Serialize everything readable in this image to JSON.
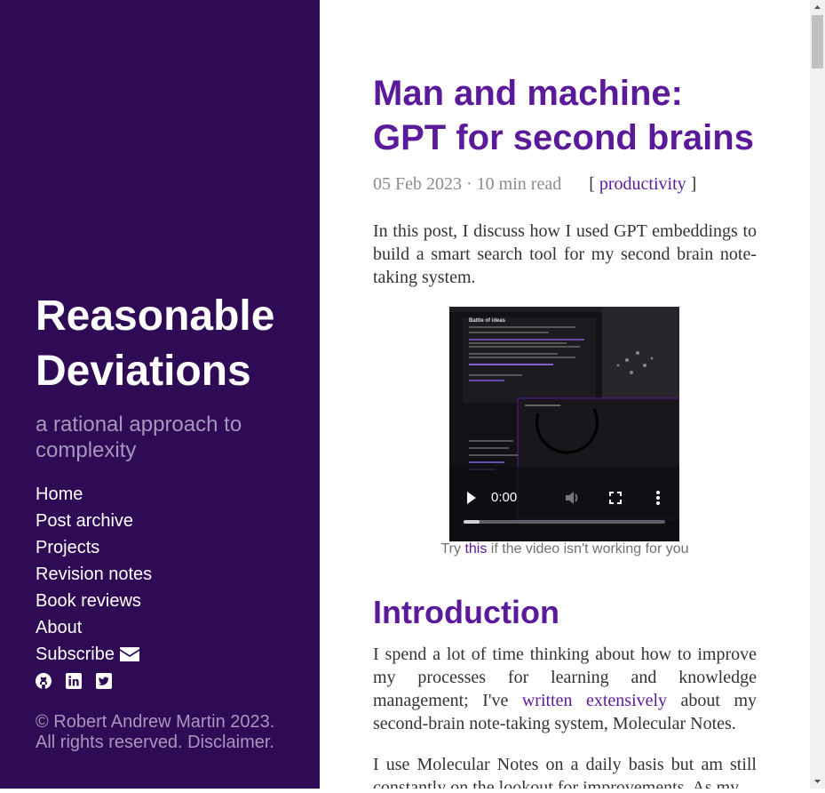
{
  "sidebar": {
    "site_title": "Reasonable Deviations",
    "tagline": "a rational approach to complexity",
    "nav": [
      {
        "label": "Home"
      },
      {
        "label": "Post archive"
      },
      {
        "label": "Projects"
      },
      {
        "label": "Revision notes"
      },
      {
        "label": "Book reviews"
      },
      {
        "label": "About"
      },
      {
        "label": "Subscribe",
        "icon": "envelope-icon"
      }
    ],
    "social_icons": [
      "github-icon",
      "linkedin-icon",
      "twitter-icon"
    ],
    "footer": {
      "copyright": "© Robert Andrew Martin 2023.",
      "rights": "All rights reserved. Disclaimer."
    }
  },
  "post": {
    "title_line1": "Man and machine:",
    "title_line2": "GPT for second brains",
    "date": "05 Feb 2023",
    "separator": "·",
    "read_time": "10 min read",
    "tag_open": "[",
    "tag": "productivity",
    "tag_close": "]",
    "intro_paragraph": "In this post, I discuss how I used GPT embeddings to build a smart search tool for my second brain note-taking system.",
    "video": {
      "time": "0:00",
      "progress": 0.08,
      "embedded_title": "Battle of ideas"
    },
    "caption_prefix": "Try",
    "caption_link": "this",
    "caption_suffix": "if the video isn't working for you",
    "section_heading": "Introduction",
    "p2_before": "I spend a lot of time thinking about how to improve my processes for learning and knowledge management; I've",
    "p2_link": "written extensively",
    "p2_after": "about my second-brain note-taking system, Molecular Notes.",
    "p3": "I use Molecular Notes on a daily basis but am still constantly on the lookout for improvements. As my"
  },
  "colors": {
    "sidebar_bg": "#2f0b55",
    "accent": "#5b1a9a",
    "muted": "#a796bd"
  }
}
